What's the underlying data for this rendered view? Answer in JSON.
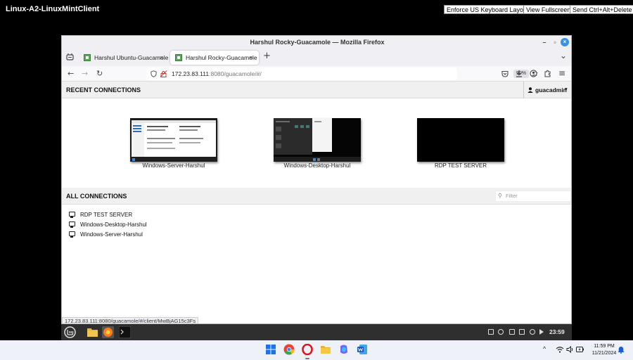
{
  "session": {
    "title": "Linux-A2-LinuxMintClient",
    "buttons": [
      "Enforce US Keyboard Layout",
      "View Fullscreen",
      "Send Ctrl+Alt+Delete"
    ]
  },
  "firefox": {
    "window_title": "Harshul Rocky-Guacamole — Mozilla Firefox",
    "tabs": [
      {
        "label": "Harshul Ubuntu-Guacamole",
        "active": false
      },
      {
        "label": "Harshul Rocky-Guacamole",
        "active": true
      }
    ],
    "url_host": "172.23.83.111",
    "url_rest": ":8080/guacamole/#/",
    "zoom": "90%",
    "status_url": "172.23.83.111:8080/guacamole/#/client/MwBjAG15c3Fs"
  },
  "guacamole": {
    "recent_title": "RECENT CONNECTIONS",
    "username": "guacadmin",
    "recent": [
      {
        "name": "Windows-Server-Harshul",
        "kind": "server"
      },
      {
        "name": "Windows-Desktop-Harshul",
        "kind": "desktop"
      },
      {
        "name": "RDP TEST SERVER",
        "kind": "black"
      }
    ],
    "all_title": "ALL CONNECTIONS",
    "filter_placeholder": "Filter",
    "connections": [
      "RDP TEST SERVER",
      "Windows-Desktop-Harshul",
      "Windows-Server-Harshul"
    ]
  },
  "mint_panel": {
    "clock": "23:59"
  },
  "windows_taskbar": {
    "time": "11:59 PM",
    "date": "11/21/2024"
  },
  "icons": {
    "close": "×",
    "plus": "+",
    "chevron_down": "⌄",
    "back": "←",
    "forward": "→",
    "reload": "↻",
    "star": "☆",
    "menu": "≡",
    "caret": "▾",
    "search": "⚲",
    "minimize": "–",
    "maximize": "▫",
    "up_chevron": "^"
  }
}
